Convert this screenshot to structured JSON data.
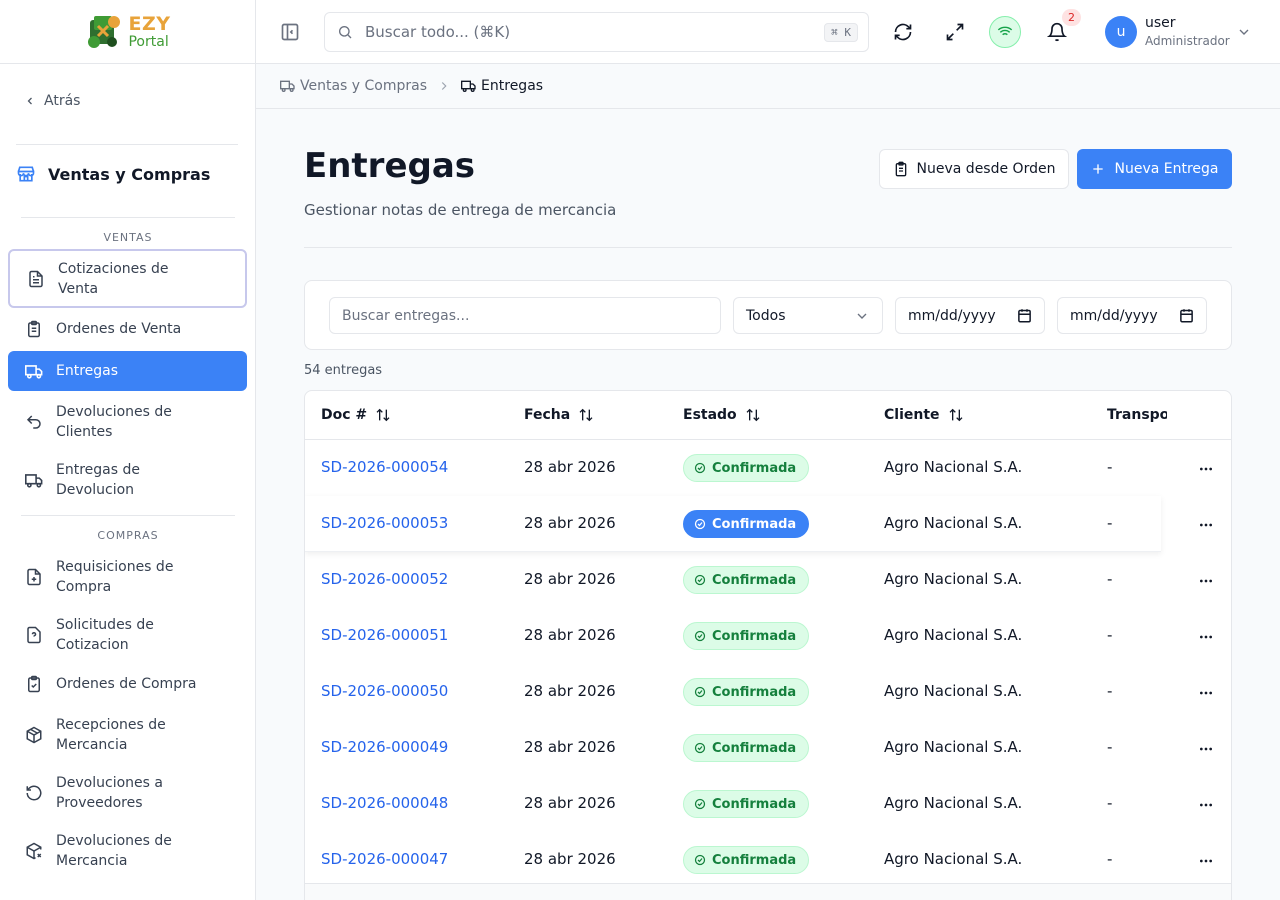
{
  "brand": {
    "name_top": "EZY",
    "name_bottom": "Portal"
  },
  "sidebar": {
    "back_label": "Atrás",
    "module_title": "Ventas y Compras",
    "sales_section_label": "VENTAS",
    "purchases_section_label": "COMPRAS",
    "sales_items": [
      {
        "line1": "Cotizaciones de",
        "line2": "Venta",
        "icon": "file-text-icon"
      },
      {
        "line1": "Ordenes de Venta",
        "line2": "",
        "icon": "clipboard-list-icon"
      },
      {
        "line1": "Entregas",
        "line2": "",
        "icon": "truck-icon"
      },
      {
        "line1": "Devoluciones de",
        "line2": "Clientes",
        "icon": "undo-icon"
      },
      {
        "line1": "Entregas de",
        "line2": "Devolucion",
        "icon": "truck-return-icon"
      }
    ],
    "purchase_items": [
      {
        "line1": "Requisiciones de",
        "line2": "Compra",
        "icon": "file-plus-icon"
      },
      {
        "line1": "Solicitudes de",
        "line2": "Cotizacion",
        "icon": "file-question-icon"
      },
      {
        "line1": "Ordenes de Compra",
        "line2": "",
        "icon": "clipboard-check-icon"
      },
      {
        "line1": "Recepciones de",
        "line2": "Mercancia",
        "icon": "package-icon"
      },
      {
        "line1": "Devoluciones a",
        "line2": "Proveedores",
        "icon": "rotate-ccw-icon"
      },
      {
        "line1": "Devoluciones de",
        "line2": "Mercancia",
        "icon": "package-x-icon"
      }
    ]
  },
  "topbar": {
    "search_placeholder": "Buscar todo... (⌘K)",
    "search_shortcut": "⌘ K",
    "notifications_count": "2",
    "user": {
      "initial": "u",
      "name": "user",
      "role": "Administrador"
    }
  },
  "breadcrumb": {
    "parent": "Ventas y Compras",
    "current": "Entregas"
  },
  "page": {
    "title": "Entregas",
    "subtitle": "Gestionar notas de entrega de mercancia",
    "btn_from_order": "Nueva desde Orden",
    "btn_new": "Nueva Entrega"
  },
  "filters": {
    "search_placeholder": "Buscar entregas...",
    "status_value": "Todos",
    "date_from": "mm/dd/yyyy",
    "date_to": "mm/dd/yyyy"
  },
  "count_label": "54 entregas",
  "table": {
    "columns": [
      "Doc #",
      "Fecha",
      "Estado",
      "Cliente",
      "Transportista"
    ],
    "rows": [
      {
        "doc": "SD-2026-000054",
        "date": "28 abr 2026",
        "status": "Confirmada",
        "client": "Agro Nacional S.A.",
        "carrier": "-"
      },
      {
        "doc": "SD-2026-000053",
        "date": "28 abr 2026",
        "status": "Confirmada",
        "client": "Agro Nacional S.A.",
        "carrier": "-"
      },
      {
        "doc": "SD-2026-000052",
        "date": "28 abr 2026",
        "status": "Confirmada",
        "client": "Agro Nacional S.A.",
        "carrier": "-"
      },
      {
        "doc": "SD-2026-000051",
        "date": "28 abr 2026",
        "status": "Confirmada",
        "client": "Agro Nacional S.A.",
        "carrier": "-"
      },
      {
        "doc": "SD-2026-000050",
        "date": "28 abr 2026",
        "status": "Confirmada",
        "client": "Agro Nacional S.A.",
        "carrier": "-"
      },
      {
        "doc": "SD-2026-000049",
        "date": "28 abr 2026",
        "status": "Confirmada",
        "client": "Agro Nacional S.A.",
        "carrier": "-"
      },
      {
        "doc": "SD-2026-000048",
        "date": "28 abr 2026",
        "status": "Confirmada",
        "client": "Agro Nacional S.A.",
        "carrier": "-"
      },
      {
        "doc": "SD-2026-000047",
        "date": "28 abr 2026",
        "status": "Confirmada",
        "client": "Agro Nacional S.A.",
        "carrier": "-"
      }
    ]
  },
  "colors": {
    "primary": "#3b82f6",
    "link": "#2563eb",
    "badge_bg": "#dcfce7",
    "badge_text": "#15803d",
    "logo_orange": "#e8a33a",
    "logo_green": "#3f9b35"
  }
}
